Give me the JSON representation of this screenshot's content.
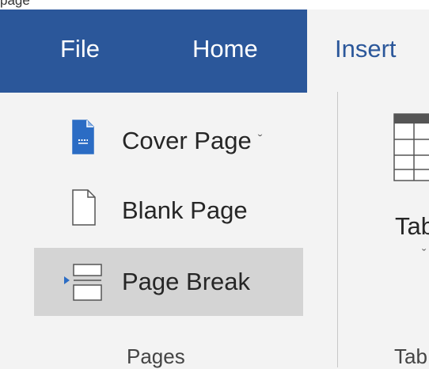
{
  "header": {
    "clipped_text": "page"
  },
  "tabs": [
    {
      "label": "File"
    },
    {
      "label": "Home"
    },
    {
      "label": "Insert",
      "active": true
    }
  ],
  "pages_group": {
    "commands": [
      {
        "label": "Cover Page",
        "icon": "cover-page-icon",
        "has_dropdown": true,
        "dropdown_glyph": "ˇ"
      },
      {
        "label": "Blank Page",
        "icon": "blank-page-icon"
      },
      {
        "label": "Page Break",
        "icon": "page-break-icon",
        "hovered": true
      }
    ],
    "group_label": "Pages"
  },
  "tables_group": {
    "button_label": "Tab",
    "group_label": "Tab"
  },
  "colors": {
    "tab_bar": "#2b579a",
    "ribbon_bg": "#f3f3f3",
    "hover_bg": "#d4d4d4",
    "icon_blue": "#2b6cc4"
  }
}
